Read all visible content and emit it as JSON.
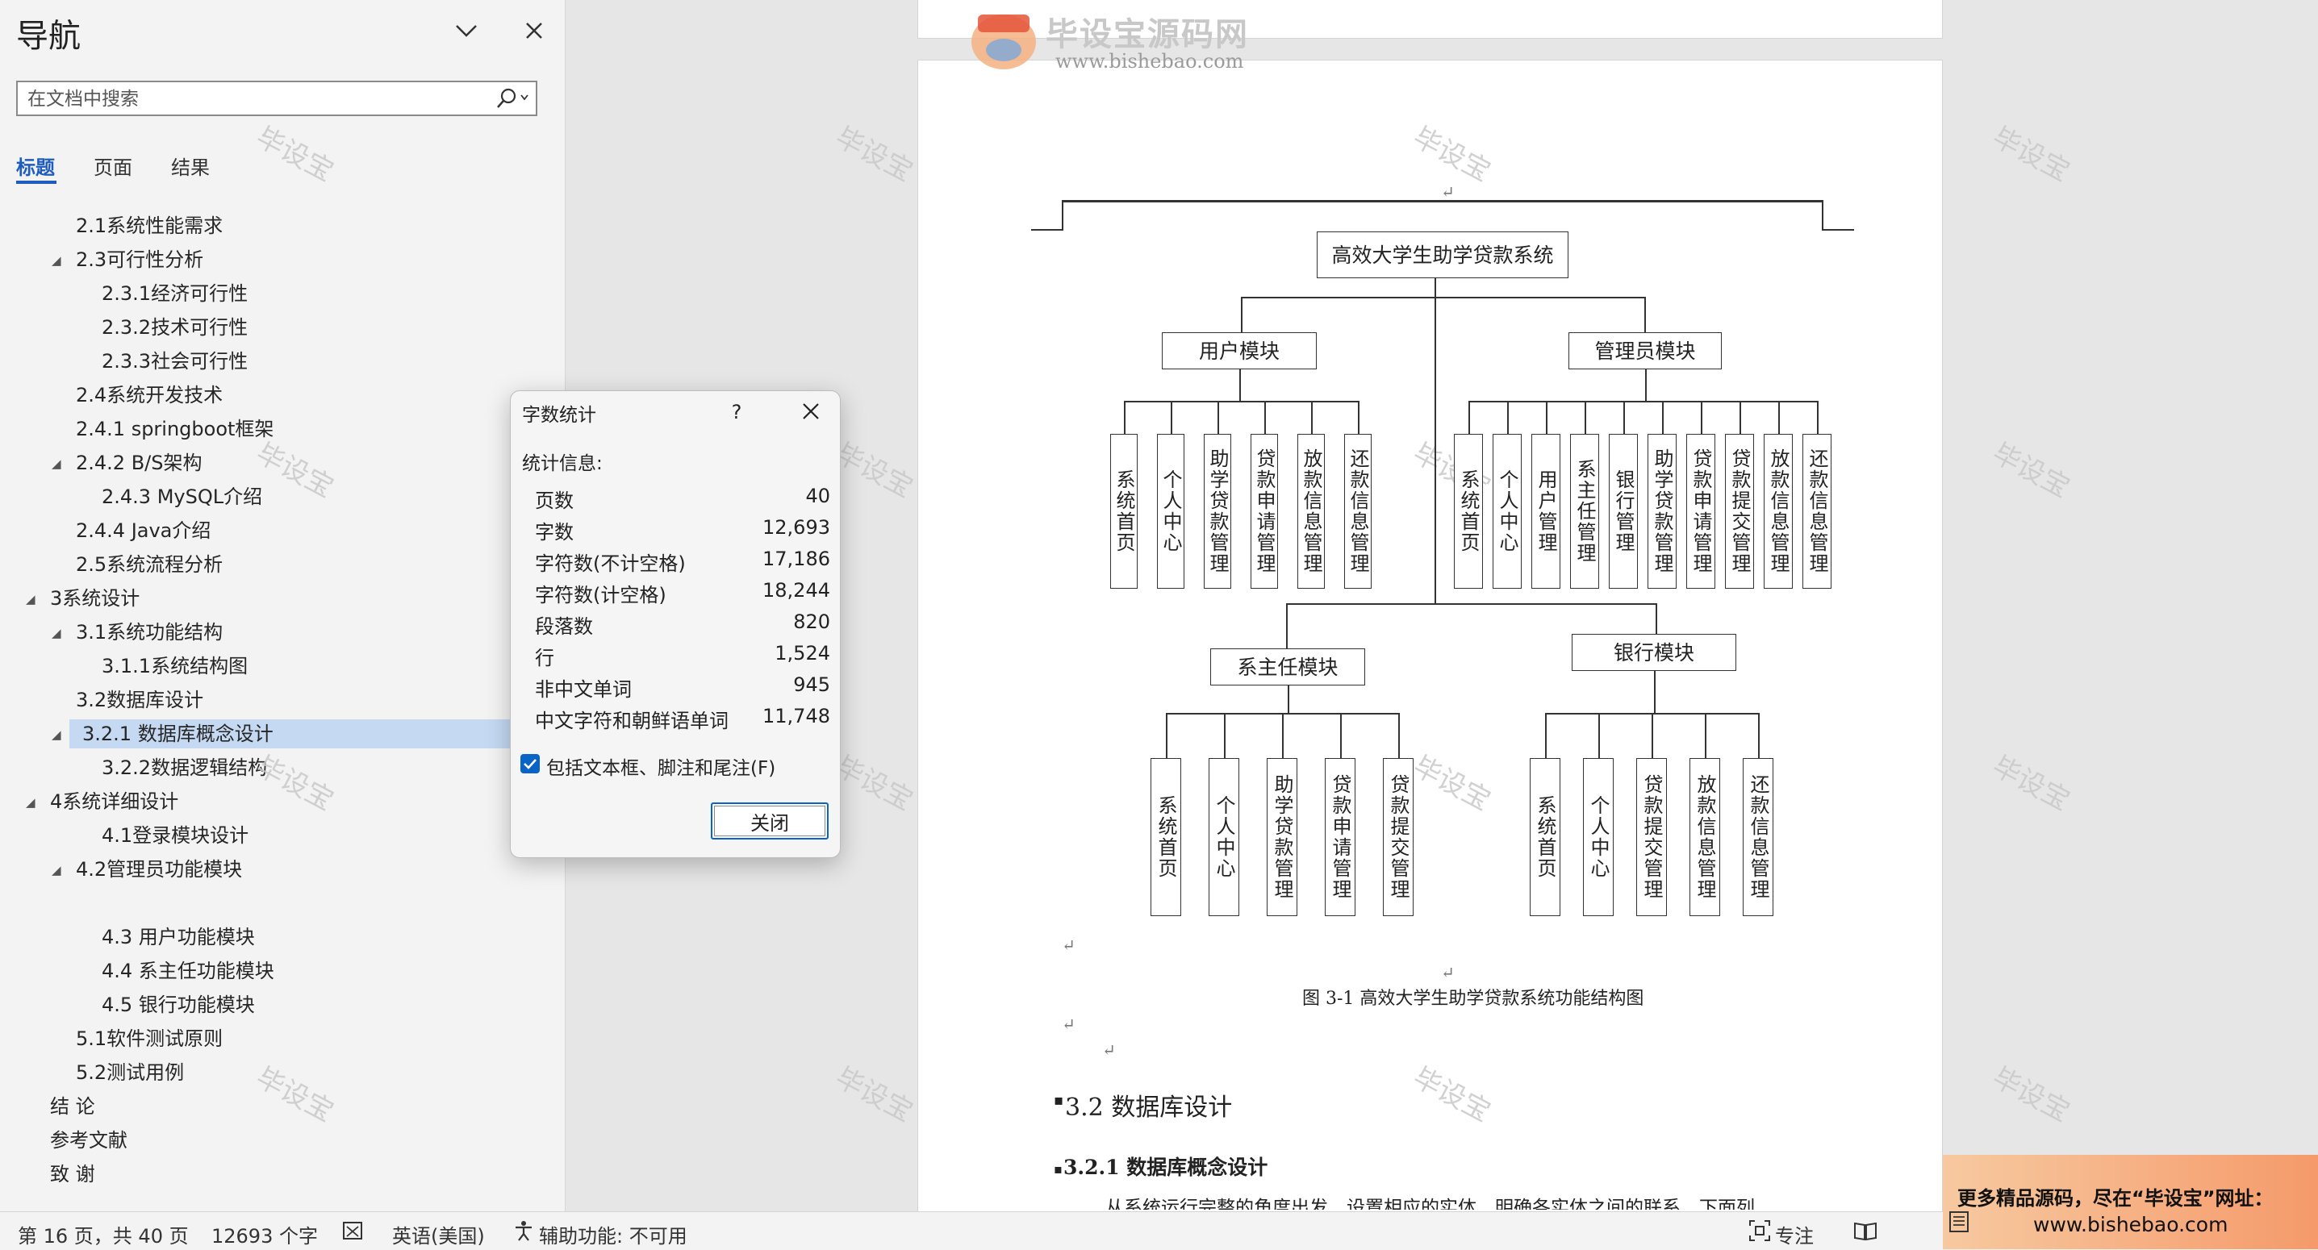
{
  "nav": {
    "title": "导航",
    "search_placeholder": "在文档中搜索",
    "tabs": [
      "标题",
      "页面",
      "结果"
    ],
    "items": [
      {
        "label": "2.1系统性能需求",
        "level": 2,
        "arrow": false
      },
      {
        "label": "2.3可行性分析",
        "level": 2,
        "arrow": true
      },
      {
        "label": "2.3.1经济可行性",
        "level": 3,
        "arrow": false
      },
      {
        "label": "2.3.2技术可行性",
        "level": 3,
        "arrow": false
      },
      {
        "label": "2.3.3社会可行性",
        "level": 3,
        "arrow": false
      },
      {
        "label": "2.4系统开发技术",
        "level": 2,
        "arrow": false
      },
      {
        "label": "2.4.1 springboot框架",
        "level": 2,
        "arrow": false
      },
      {
        "label": "2.4.2 B/S架构",
        "level": 2,
        "arrow": true
      },
      {
        "label": "2.4.3 MySQL介绍",
        "level": 3,
        "arrow": false
      },
      {
        "label": "2.4.4 Java介绍",
        "level": 2,
        "arrow": false
      },
      {
        "label": "2.5系统流程分析",
        "level": 2,
        "arrow": false
      },
      {
        "label": "3系统设计",
        "level": 1,
        "arrow": true
      },
      {
        "label": "3.1系统功能结构",
        "level": 2,
        "arrow": true
      },
      {
        "label": "3.1.1系统结构图",
        "level": 3,
        "arrow": false
      },
      {
        "label": "3.2数据库设计",
        "level": 2,
        "arrow": false
      },
      {
        "label": "3.2.1 数据库概念设计",
        "level": 2,
        "arrow": true,
        "selected": true
      },
      {
        "label": "3.2.2数据逻辑结构",
        "level": 3,
        "arrow": false
      },
      {
        "label": "4系统详细设计",
        "level": 1,
        "arrow": true
      },
      {
        "label": "4.1登录模块设计",
        "level": 3,
        "arrow": false
      },
      {
        "label": "4.2管理员功能模块",
        "level": 2,
        "arrow": true
      },
      {
        "label": "",
        "level": 3,
        "arrow": false
      },
      {
        "label": "4.3 用户功能模块",
        "level": 3,
        "arrow": false
      },
      {
        "label": "4.4 系主任功能模块",
        "level": 3,
        "arrow": false
      },
      {
        "label": "4.5 银行功能模块",
        "level": 3,
        "arrow": false
      },
      {
        "label": "5.1软件测试原则",
        "level": 2,
        "arrow": false
      },
      {
        "label": "5.2测试用例",
        "level": 2,
        "arrow": false
      },
      {
        "label": "结  论",
        "level": 1,
        "arrow": false
      },
      {
        "label": "参考文献",
        "level": 1,
        "arrow": false
      },
      {
        "label": "致  谢",
        "level": 1,
        "arrow": false
      }
    ]
  },
  "dialog": {
    "title": "字数统计",
    "help": "?",
    "section": "统计信息:",
    "stats": [
      {
        "label": "页数",
        "value": "40"
      },
      {
        "label": "字数",
        "value": "12,693"
      },
      {
        "label": "字符数(不计空格)",
        "value": "17,186"
      },
      {
        "label": "字符数(计空格)",
        "value": "18,244"
      },
      {
        "label": "段落数",
        "value": "820"
      },
      {
        "label": "行",
        "value": "1,524"
      },
      {
        "label": "非中文单词",
        "value": "945"
      },
      {
        "label": "中文字符和朝鲜语单词",
        "value": "11,748"
      }
    ],
    "checkbox_label": "包括文本框、脚注和尾注(F)",
    "checkbox_checked": true,
    "close_button": "关闭"
  },
  "watermark": {
    "logo_cn": "毕设宝源码网",
    "logo_badge": "毕设宝",
    "logo_url": "www.bishebao.com",
    "text": "毕设宝"
  },
  "diagram": {
    "root": "高效大学生助学贷款系统",
    "modules": [
      {
        "name": "用户模块",
        "children": [
          "系统首页",
          "个人中心",
          "助学贷款管理",
          "贷款申请管理",
          "放款信息管理",
          "还款信息管理"
        ]
      },
      {
        "name": "管理员模块",
        "children": [
          "系统首页",
          "个人中心",
          "用户管理",
          "系主任管理",
          "银行管理",
          "助学贷款管理",
          "贷款申请管理",
          "贷款提交管理",
          "放款信息管理",
          "还款信息管理"
        ]
      },
      {
        "name": "系主任模块",
        "children": [
          "系统首页",
          "个人中心",
          "助学贷款管理",
          "贷款申请管理",
          "贷款提交管理"
        ]
      },
      {
        "name": "银行模块",
        "children": [
          "系统首页",
          "个人中心",
          "贷款提交管理",
          "放款信息管理",
          "还款信息管理"
        ]
      }
    ],
    "caption": "图 3-1  高效大学生助学贷款系统功能结构图"
  },
  "document": {
    "return_mark": "↵",
    "heading_32": "3.2 数据库设计",
    "heading_321": "3.2.1  数据库概念设计",
    "paragraph": "从系统运行完整的角度出发，设置相应的实体，明确各实体之间的联系。下面列"
  },
  "status": {
    "page": "第 16 页，共 40 页",
    "words": "12693 个字",
    "language": "英语(美国)",
    "accessibility": "辅助功能: 不可用",
    "focus": "专注"
  },
  "promo": {
    "line1": "更多精品源码，尽在“毕设宝”网址：",
    "line2": "www.bishebao.com"
  },
  "colors": {
    "accent": "#1e5dbf",
    "selection": "#c5d9f3",
    "checkbox": "#0a64c8"
  }
}
